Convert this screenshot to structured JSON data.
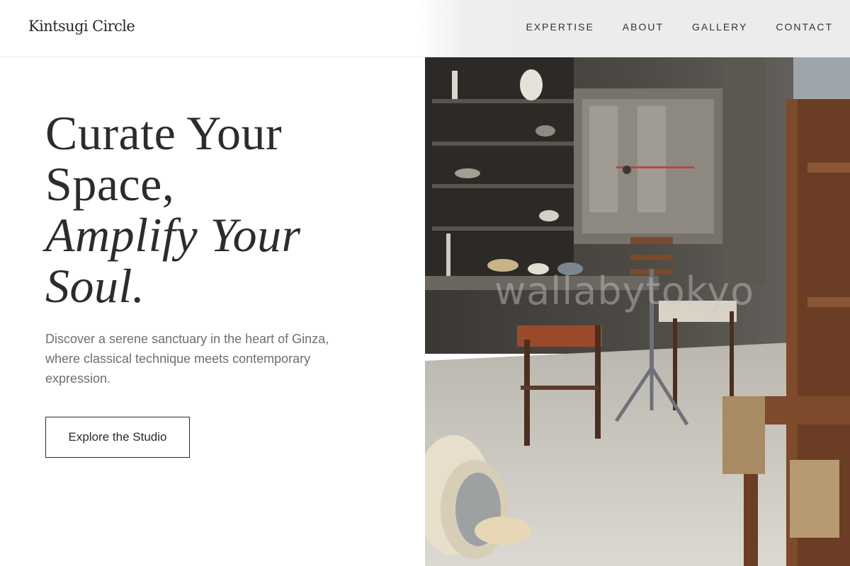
{
  "brand": {
    "logo_text": "Kintsugi Circle"
  },
  "nav": {
    "items": [
      {
        "label": "EXPERTISE"
      },
      {
        "label": "ABOUT"
      },
      {
        "label": "GALLERY"
      },
      {
        "label": "CONTACT"
      }
    ]
  },
  "hero": {
    "headline": {
      "line1": "Curate Your",
      "line2": "Space,",
      "line3": "Amplify Your",
      "line4": "Soul."
    },
    "description": "Discover a serene sanctuary in the heart of Ginza, where classical technique meets contemporary expression.",
    "cta_label": "Explore the Studio"
  },
  "image": {
    "subject": "pottery studio interior",
    "watermark": "wallabytokyo"
  },
  "colors": {
    "text": "#2b2b2b",
    "muted": "#6f6f6f",
    "background": "#ffffff"
  }
}
